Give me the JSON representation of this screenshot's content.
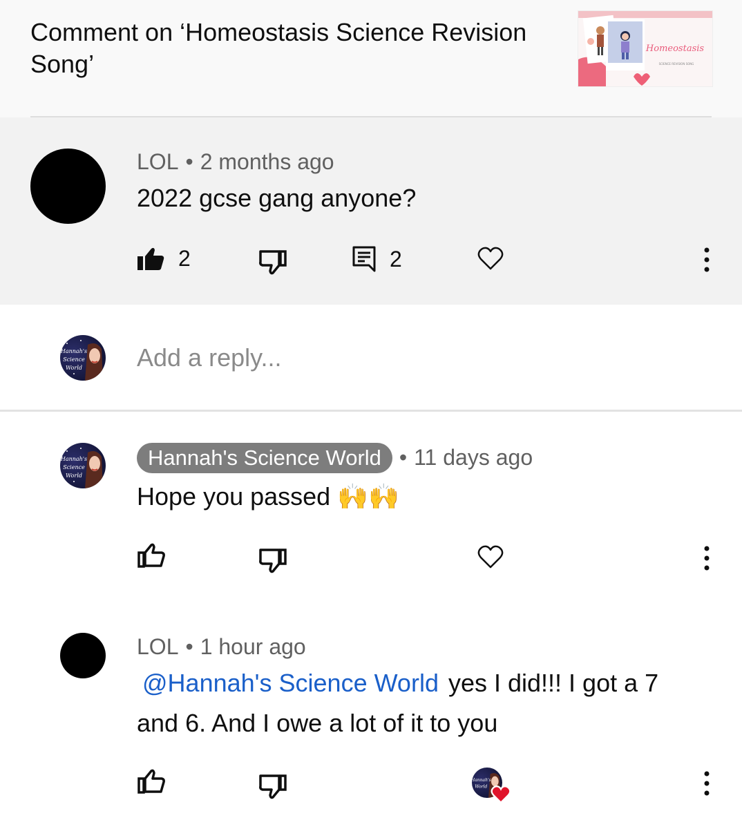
{
  "header": {
    "title": "Comment on ‘Homeostasis Science Revision Song’",
    "thumbnail_text": "Homeostasis",
    "thumbnail_subtext": "SCIENCE REVISION SONG"
  },
  "main_comment": {
    "author": "LOL",
    "separator": "•",
    "time": "2 months ago",
    "text": "2022 gcse gang anyone?",
    "like_count": "2",
    "reply_count": "2",
    "like_icon": "thumb-up-filled-icon",
    "dislike_icon": "thumb-down-icon",
    "reply_icon": "comment-icon",
    "heart_icon": "heart-outline-icon",
    "menu_icon": "more-vert-icon"
  },
  "reply_box": {
    "placeholder": "Add a reply...",
    "avatar_text": "Hannah's Science World"
  },
  "replies": [
    {
      "author": "Hannah's Science World",
      "separator": "•",
      "time": "11 days ago",
      "text": "Hope you passed",
      "emoji": "🙌🙌",
      "avatar_text": "Hannah's Science World"
    },
    {
      "author": "LOL",
      "separator": "•",
      "time": "1 hour ago",
      "mention": "@Hannah's Science World",
      "text": "yes I did!!! I got a 7 and 6. And I owe a lot of it to you",
      "hearted_by_text": "Hannah's Science World"
    }
  ],
  "colors": {
    "header_bg": "#f9f9f9",
    "highlight_bg": "#f2f2f2",
    "meta_text": "#606060",
    "mention": "#1a5fc9",
    "chip_bg": "#7d7d7d",
    "heart": "#e0142b"
  }
}
